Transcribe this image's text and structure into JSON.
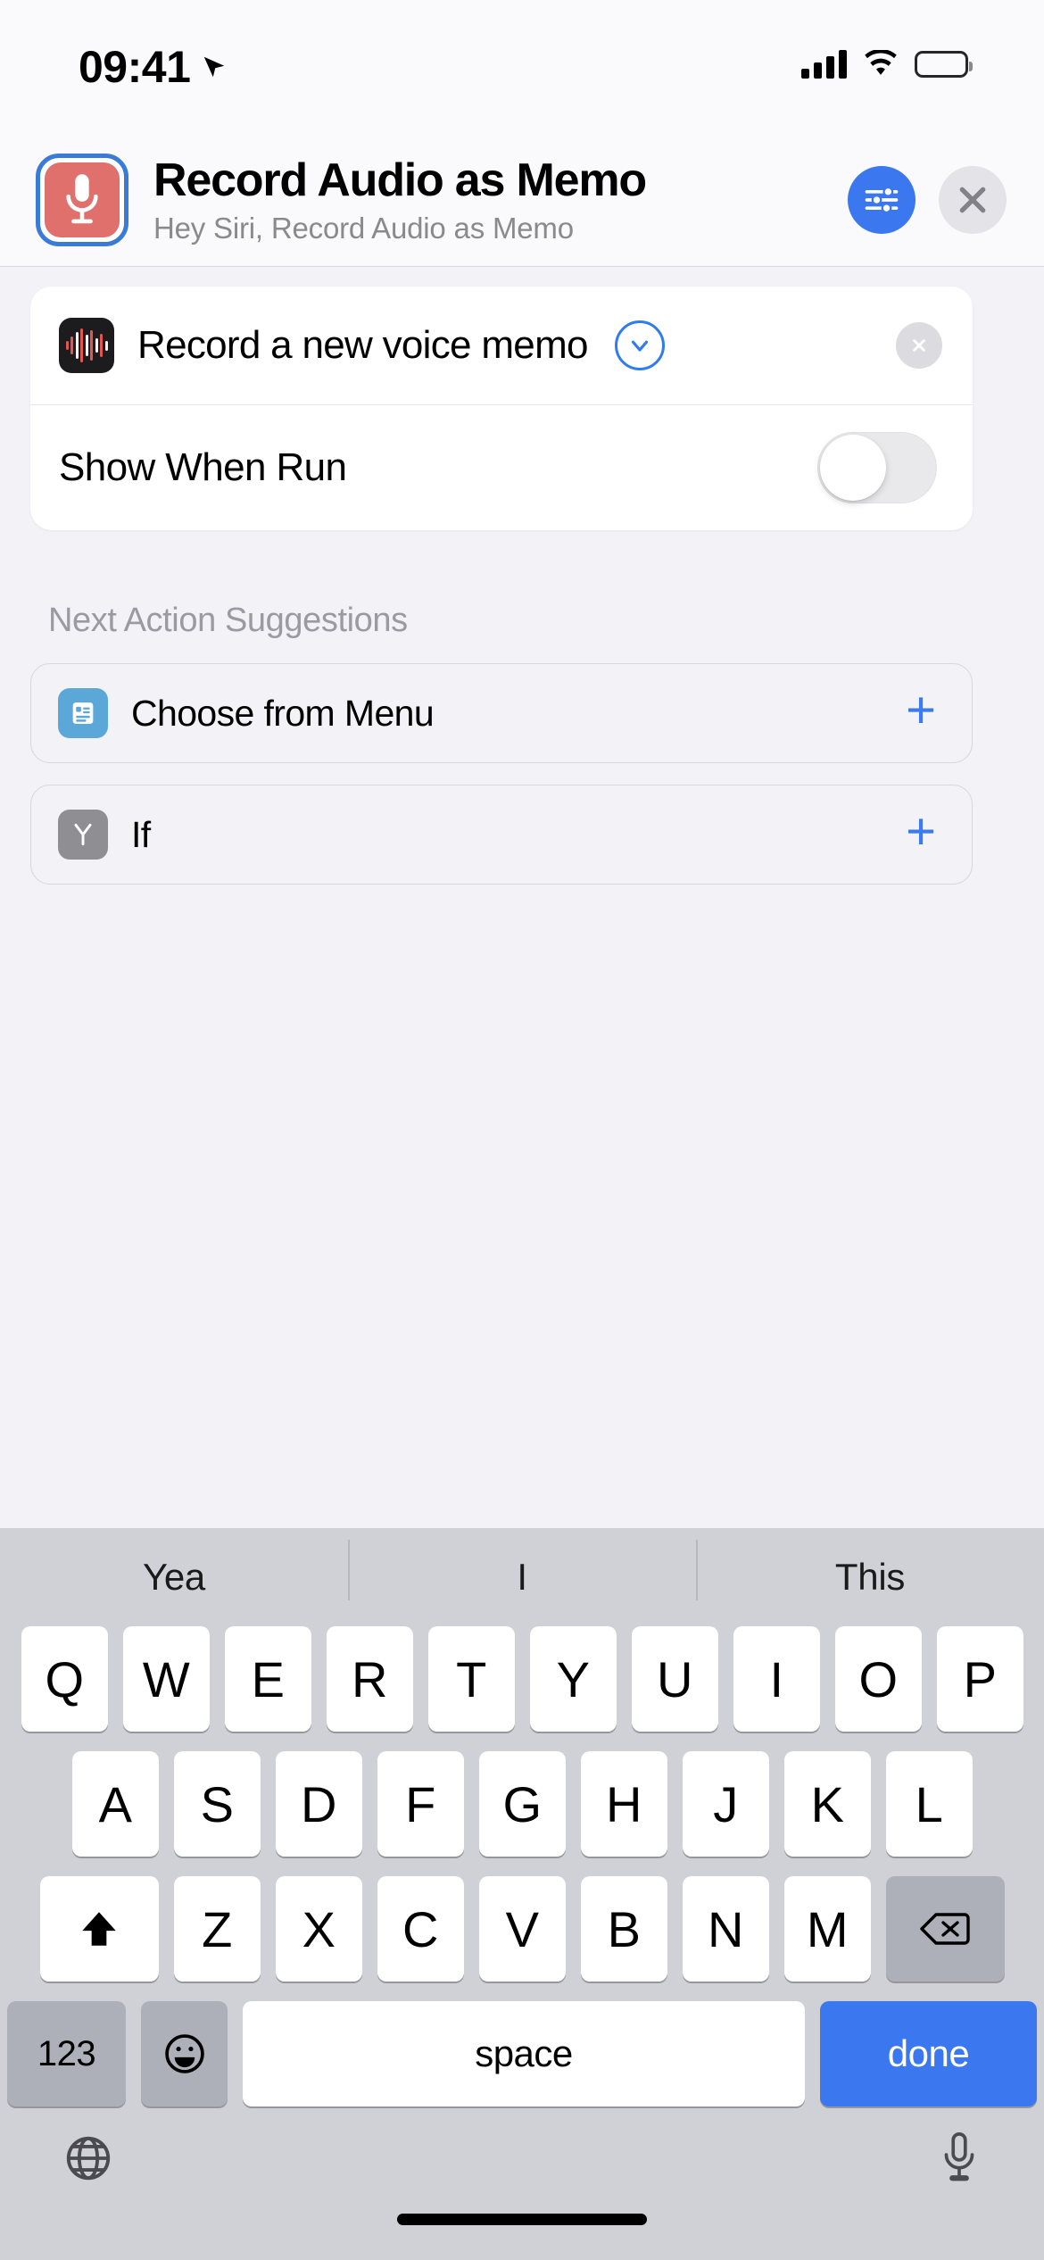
{
  "status_bar": {
    "time": "09:41",
    "location_icon": "location-arrow-icon",
    "cellular_icon": "cellular-bars-icon",
    "wifi_icon": "wifi-icon",
    "battery_icon": "battery-full-icon"
  },
  "header": {
    "app_icon": "microphone-icon",
    "title": "Record Audio as Memo",
    "subtitle": "Hey Siri, Record Audio as Memo",
    "settings_button": "settings-sliders-icon",
    "close_button": "close-x-icon"
  },
  "action_card": {
    "icon": "voice-memos-waveform-icon",
    "title": "Record a new voice memo",
    "expand_icon": "chevron-down-icon",
    "remove_icon": "remove-x-icon",
    "toggle": {
      "label": "Show When Run",
      "state": "off"
    }
  },
  "suggestions": {
    "section_label": "Next Action Suggestions",
    "items": [
      {
        "label": "Choose from Menu",
        "icon": "menu-list-icon",
        "icon_color": "#5BA8D8",
        "add_icon": "plus-icon"
      },
      {
        "label": "If",
        "icon": "branch-if-icon",
        "icon_color": "#8E8E93",
        "add_icon": "plus-icon"
      }
    ]
  },
  "keyboard": {
    "predictions": [
      "Yea",
      "I",
      "This"
    ],
    "row1": [
      "Q",
      "W",
      "E",
      "R",
      "T",
      "Y",
      "U",
      "I",
      "O",
      "P"
    ],
    "row2": [
      "A",
      "S",
      "D",
      "F",
      "G",
      "H",
      "J",
      "K",
      "L"
    ],
    "row3_letters": [
      "Z",
      "X",
      "C",
      "V",
      "B",
      "N",
      "M"
    ],
    "shift_key": "shift-arrow-icon",
    "backspace_key": "backspace-icon",
    "numbers_key": "123",
    "emoji_key": "emoji-smiley-icon",
    "space_key": "space",
    "return_key": "done",
    "globe_key": "globe-icon",
    "dictation_key": "microphone-icon"
  },
  "colors": {
    "accent_blue": "#3B77EF",
    "app_red": "#E0706B",
    "keyboard_bg": "#CFD1D7",
    "page_bg": "#F2F2F7"
  }
}
